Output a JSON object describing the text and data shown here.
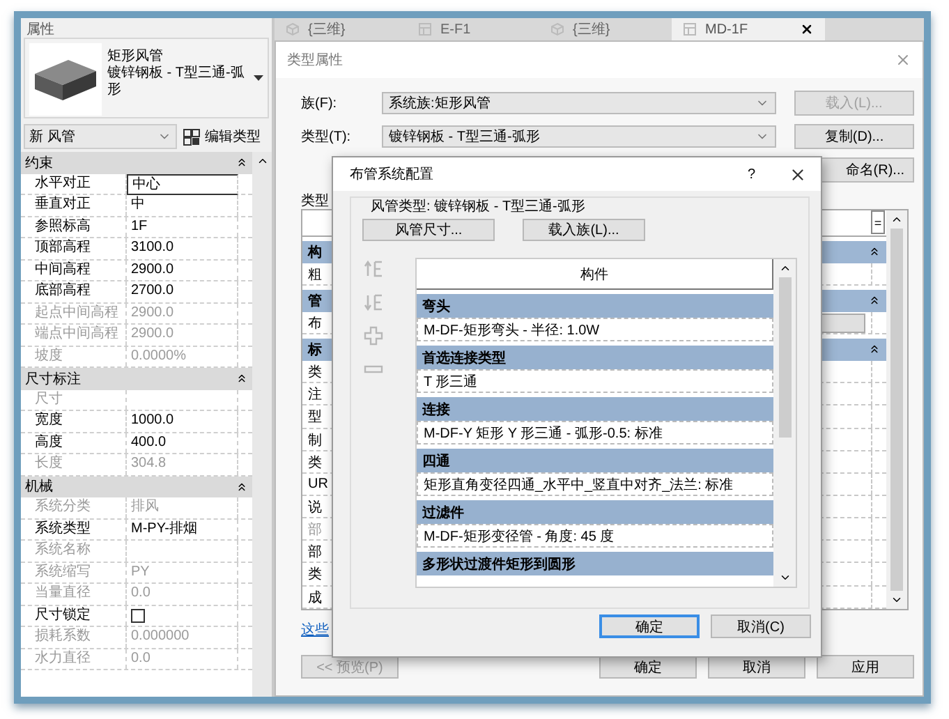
{
  "tabs": [
    {
      "label": "{三维}",
      "kind": "view3d",
      "selected": false
    },
    {
      "label": "E-F1",
      "kind": "plan",
      "selected": false
    },
    {
      "label": "{三维}",
      "kind": "view3d",
      "selected": false
    },
    {
      "label": "MD-1F",
      "kind": "plan",
      "selected": true
    }
  ],
  "properties": {
    "title": "属性",
    "type_name": "矩形风管",
    "type_sub": "镀锌钢板 - T型三通-弧形",
    "instance_select": "新 风管",
    "edit_type": "编辑类型",
    "groups": [
      {
        "name": "约束",
        "rows": [
          {
            "label": "水平对正",
            "value": "中心",
            "kind": "text",
            "disabled": false,
            "selected": true
          },
          {
            "label": "垂直对正",
            "value": "中",
            "kind": "text",
            "disabled": false,
            "selected": false
          },
          {
            "label": "参照标高",
            "value": "1F",
            "kind": "text",
            "disabled": false,
            "selected": false
          },
          {
            "label": "顶部高程",
            "value": "3100.0",
            "kind": "text",
            "disabled": false,
            "selected": false
          },
          {
            "label": "中间高程",
            "value": "2900.0",
            "kind": "text",
            "disabled": false,
            "selected": false
          },
          {
            "label": "底部高程",
            "value": "2700.0",
            "kind": "text",
            "disabled": false,
            "selected": false
          },
          {
            "label": "起点中间高程",
            "value": "2900.0",
            "kind": "text",
            "disabled": true,
            "selected": false
          },
          {
            "label": "端点中间高程",
            "value": "2900.0",
            "kind": "text",
            "disabled": true,
            "selected": false
          },
          {
            "label": "坡度",
            "value": "0.0000%",
            "kind": "text",
            "disabled": true,
            "selected": false
          }
        ]
      },
      {
        "name": "尺寸标注",
        "rows": [
          {
            "label": "尺寸",
            "kind": "text",
            "disabled": true,
            "selected": false
          },
          {
            "label": "宽度",
            "value": "1000.0",
            "kind": "text",
            "disabled": false,
            "selected": false
          },
          {
            "label": "高度",
            "value": "400.0",
            "kind": "text",
            "disabled": false,
            "selected": false
          },
          {
            "label": "长度",
            "value": "304.8",
            "kind": "text",
            "disabled": true,
            "selected": false
          }
        ]
      },
      {
        "name": "机械",
        "rows": [
          {
            "label": "系统分类",
            "value": "排风",
            "kind": "text",
            "disabled": true,
            "selected": false
          },
          {
            "label": "系统类型",
            "value": "M-PY-排烟",
            "kind": "text",
            "disabled": false,
            "selected": false
          },
          {
            "label": "系统名称",
            "kind": "text",
            "disabled": true,
            "selected": false
          },
          {
            "label": "系统缩写",
            "value": "PY",
            "kind": "text",
            "disabled": true,
            "selected": false
          },
          {
            "label": "当量直径",
            "value": "0.0",
            "kind": "text",
            "disabled": true,
            "selected": false
          },
          {
            "label": "尺寸锁定",
            "kind": "checkbox",
            "checked": false,
            "disabled": false,
            "selected": false
          },
          {
            "label": "损耗系数",
            "value": "0.000000",
            "kind": "text",
            "disabled": true,
            "selected": false
          },
          {
            "label": "水力直径",
            "value": "0.0",
            "kind": "text",
            "disabled": true,
            "selected": false
          }
        ]
      }
    ]
  },
  "type_dialog": {
    "title": "类型属性",
    "family_label": "族(F):",
    "family": "系统族:矩形风管",
    "type_label": "类型(T):",
    "type": "镀锌钢板 - T型三通-弧形",
    "side_buttons": [
      {
        "label": "载入(L)...",
        "disabled": true
      },
      {
        "label": "复制(D)...",
        "disabled": false
      },
      {
        "label": "命名(R)...",
        "disabled": false
      }
    ],
    "params_label": "类型",
    "groups": [
      {
        "name": "构",
        "rows": [
          {
            "label": "粗",
            "kind": "text",
            "disabled": false
          }
        ]
      },
      {
        "name": "管",
        "rows": [
          {
            "label": "布",
            "kind": "button",
            "disabled": false
          }
        ]
      },
      {
        "name": "标",
        "rows": [
          {
            "label": "类",
            "kind": "text",
            "disabled": false
          },
          {
            "label": "注",
            "kind": "text",
            "disabled": false
          },
          {
            "label": "型",
            "kind": "text",
            "disabled": false
          },
          {
            "label": "制",
            "kind": "text",
            "disabled": false
          },
          {
            "label": "类",
            "kind": "text",
            "disabled": false
          },
          {
            "label": "UR",
            "kind": "text",
            "disabled": false
          },
          {
            "label": "说",
            "kind": "text",
            "disabled": false
          },
          {
            "label": "部",
            "kind": "text",
            "disabled": true
          },
          {
            "label": "部",
            "kind": "text",
            "disabled": false
          },
          {
            "label": "类",
            "kind": "text",
            "disabled": false
          },
          {
            "label": "成",
            "kind": "text",
            "disabled": false
          }
        ]
      }
    ],
    "table_header_button": "=",
    "link": "这些",
    "buttons": [
      {
        "label": "<< 预览(P)",
        "disabled": true
      },
      {
        "label": "确定",
        "disabled": false
      },
      {
        "label": "取消",
        "disabled": false
      },
      {
        "label": "应用",
        "disabled": false
      }
    ]
  },
  "routing_dialog": {
    "title": "布管系统配置",
    "help": "?",
    "duct_type": "风管类型: 镀锌钢板 - T型三通-弧形",
    "top_buttons": [
      "风管尺寸...",
      "载入族(L)..."
    ],
    "tools": [
      {
        "kind": "up",
        "disabled": true
      },
      {
        "kind": "down",
        "disabled": true
      },
      {
        "kind": "add",
        "disabled": true
      },
      {
        "kind": "remove",
        "disabled": true
      }
    ],
    "column": "构件",
    "sections": [
      {
        "name": "弯头",
        "item": "M-DF-矩形弯头 - 半径: 1.0W"
      },
      {
        "name": "首选连接类型",
        "item": "T 形三通"
      },
      {
        "name": "连接",
        "item": "M-DF-Y 矩形 Y 形三通 - 弧形-0.5: 标准"
      },
      {
        "name": "四通",
        "item": "矩形直角变径四通_水平中_竖直中对齐_法兰: 标准"
      },
      {
        "name": "过滤件",
        "item": "M-DF-矩形变径管 - 角度: 45 度"
      },
      {
        "name": "多形状过渡件矩形到圆形"
      }
    ],
    "buttons": [
      {
        "label": "确定",
        "focused": true
      },
      {
        "label": "取消(C)",
        "focused": false
      }
    ]
  }
}
